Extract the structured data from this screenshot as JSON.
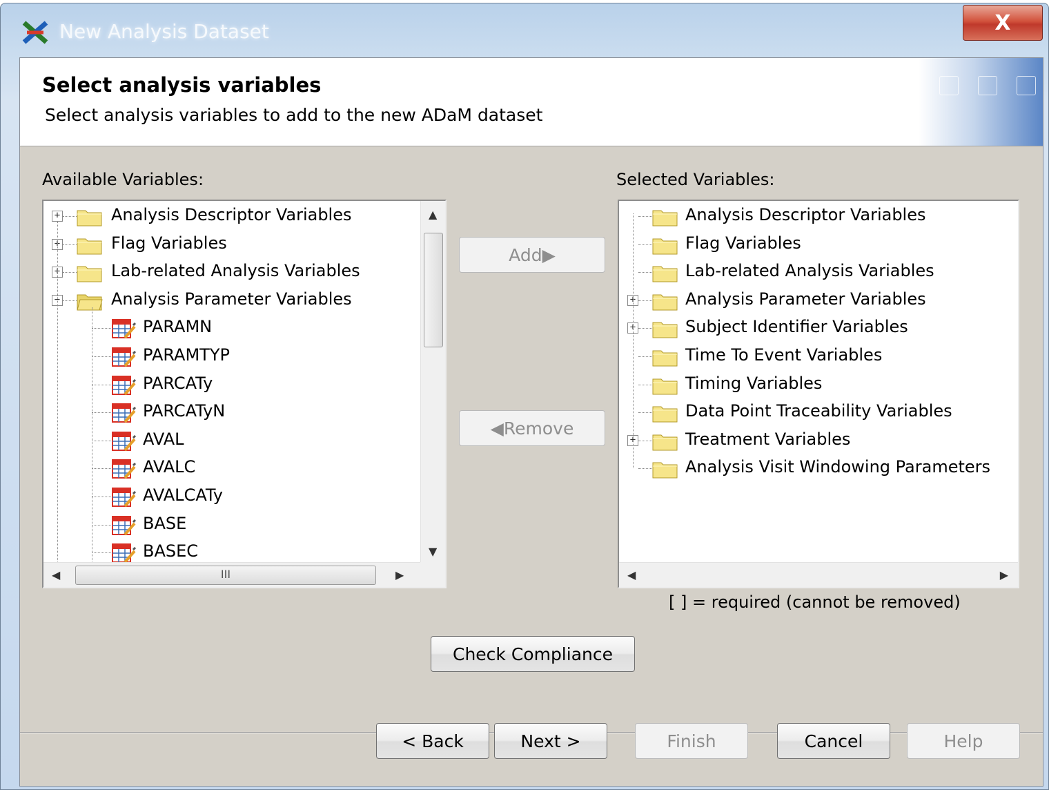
{
  "window": {
    "title": "New Analysis Dataset",
    "close_label": "X"
  },
  "header": {
    "title": "Select analysis variables",
    "subtitle": "Select analysis variables to add to the new ADaM dataset"
  },
  "available": {
    "label": "Available Variables:",
    "items": [
      {
        "label": "Analysis Descriptor Variables",
        "type": "folder",
        "expander": "+"
      },
      {
        "label": "Flag Variables",
        "type": "folder",
        "expander": "+"
      },
      {
        "label": "Lab-related Analysis Variables",
        "type": "folder",
        "expander": "+"
      },
      {
        "label": "Analysis Parameter Variables",
        "type": "folder-open",
        "expander": "-"
      },
      {
        "label": "PARAMN",
        "type": "variable"
      },
      {
        "label": "PARAMTYP",
        "type": "variable"
      },
      {
        "label": "PARCATy",
        "type": "variable"
      },
      {
        "label": "PARCATyN",
        "type": "variable"
      },
      {
        "label": "AVAL",
        "type": "variable"
      },
      {
        "label": "AVALC",
        "type": "variable"
      },
      {
        "label": "AVALCATy",
        "type": "variable"
      },
      {
        "label": "BASE",
        "type": "variable"
      },
      {
        "label": "BASEC",
        "type": "variable"
      }
    ],
    "hscroll_grip": "III"
  },
  "selected": {
    "label": "Selected Variables:",
    "items": [
      {
        "label": "Analysis Descriptor Variables",
        "expander": ""
      },
      {
        "label": "Flag Variables",
        "expander": ""
      },
      {
        "label": "Lab-related Analysis Variables",
        "expander": ""
      },
      {
        "label": "Analysis Parameter Variables",
        "expander": "+"
      },
      {
        "label": "Subject Identifier Variables",
        "expander": "+"
      },
      {
        "label": "Time To Event Variables",
        "expander": ""
      },
      {
        "label": "Timing Variables",
        "expander": ""
      },
      {
        "label": "Data Point Traceability Variables",
        "expander": ""
      },
      {
        "label": "Treatment Variables",
        "expander": "+"
      },
      {
        "label": "Analysis Visit Windowing Parameters",
        "expander": ""
      }
    ],
    "note": "[ ] = required (cannot be removed)"
  },
  "buttons": {
    "add": "Add▶",
    "remove": "◀Remove",
    "check_compliance": "Check Compliance",
    "back": "< Back",
    "next": "Next >",
    "finish": "Finish",
    "cancel": "Cancel",
    "help": "Help"
  },
  "colors": {
    "folder_fill": "#f6e58a",
    "variable_icon_accent": "#d93025"
  },
  "icons": {
    "app": "sas-dataset-icon",
    "folder": "folder-icon",
    "variable": "variable-table-icon"
  }
}
